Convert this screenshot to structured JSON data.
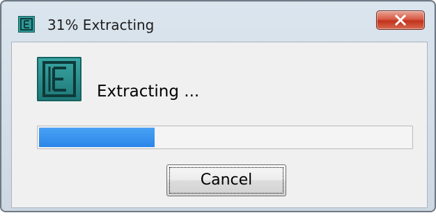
{
  "window": {
    "title": "31% Extracting",
    "app_icon": "extractor-app-icon",
    "close_icon": "close-x-icon"
  },
  "content": {
    "status_text": "Extracting ...",
    "progress": {
      "percent": 31,
      "fill_color": "#2b86e8"
    },
    "cancel_label": "Cancel"
  },
  "colors": {
    "close_button": "#c2321c",
    "app_icon": "#2e9a98"
  }
}
